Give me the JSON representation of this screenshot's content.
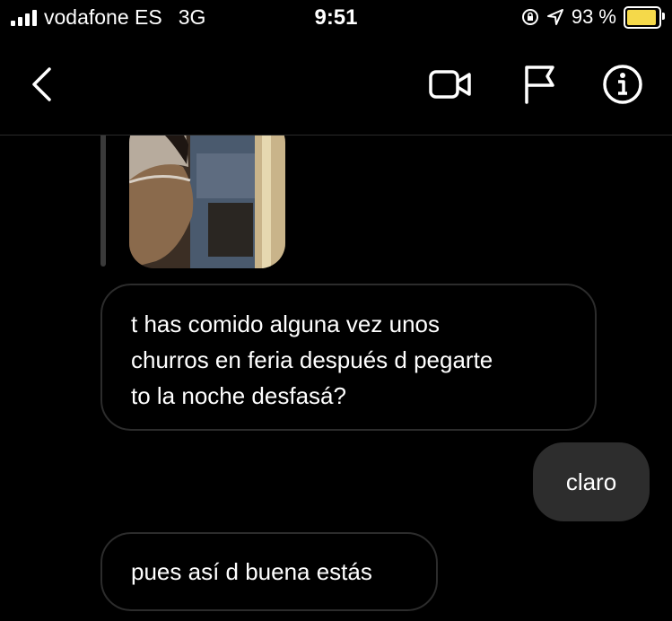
{
  "status_bar": {
    "carrier": "vodafone ES",
    "network": "3G",
    "time": "9:51",
    "battery_percent": "93 %",
    "battery_level": 0.93,
    "battery_color": "#f5d94a"
  },
  "nav": {
    "back_icon": "chevron-left-icon",
    "video_icon": "video-camera-icon",
    "flag_icon": "flag-icon",
    "info_icon": "info-icon"
  },
  "messages": [
    {
      "direction": "incoming",
      "type": "photo"
    },
    {
      "direction": "incoming",
      "lines": [
        "t has comido alguna vez unos",
        "churros en feria después d pegarte",
        "to la noche desfasá?"
      ]
    },
    {
      "direction": "outgoing",
      "text": "claro"
    },
    {
      "direction": "incoming",
      "text": "pues así d buena estás"
    }
  ]
}
